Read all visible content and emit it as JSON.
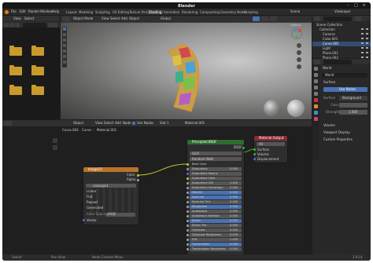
{
  "app": {
    "title": "Blender"
  },
  "menus": [
    "File",
    "Edit",
    "Render",
    "Window",
    "Help"
  ],
  "workspaces": [
    "Layout",
    "Modeling",
    "Sculpting",
    "UV Editing",
    "Texture Paint",
    "Shading",
    "Animation",
    "Rendering",
    "Compositing",
    "Geometry Nodes",
    "Scripting"
  ],
  "active_workspace": "Shading",
  "scene": "Scene",
  "view_layer": "ViewLayer",
  "file_browser": {
    "menu": [
      "View",
      "Select"
    ]
  },
  "viewport": {
    "mode": "Object Mode",
    "menu": [
      "View",
      "Select",
      "Add",
      "Object"
    ],
    "orientation": "Global",
    "options": "Options"
  },
  "outliner": {
    "root": "Scene Collection",
    "items": [
      "Collection",
      "Camera",
      "Cube.001",
      "Curve.001",
      "Light",
      "Plane.001",
      "Plane.002"
    ]
  },
  "properties": {
    "world_tab": "World",
    "world": "World",
    "surface_tab": "Surface",
    "use_nodes": "Use Nodes",
    "surface_label": "Surface",
    "surface_value": "Background",
    "color_label": "Color",
    "strength_label": "Strength",
    "strength_value": "1.000",
    "volume": "Volume",
    "viewport_display": "Viewport Display",
    "custom_props": "Custom Properties"
  },
  "node_editor": {
    "mode": "Object",
    "menu": [
      "View",
      "Select",
      "Add",
      "Node"
    ],
    "use_nodes": "Use Nodes",
    "slot": "Slot 1",
    "material": "Material.001",
    "breadcrumb": [
      "Curve.001",
      "Curve",
      "Material.001"
    ]
  },
  "image_node": {
    "title": "Image(1)",
    "color": "Color",
    "alpha": "Alpha",
    "image": "vasiurgn1",
    "linear": "Linear",
    "flat": "Flat",
    "repeat": "Repeat",
    "generated": "Generated",
    "color_space_label": "Color Space",
    "color_space": "sRGB",
    "vector": "Vector"
  },
  "bsdf_node": {
    "title": "Principled BSDF",
    "bsdf": "BSDF",
    "ggx": "GGX",
    "random_walk": "Random Walk",
    "inputs": [
      "Base Color",
      "Subsurface",
      "Subsurface Radius",
      "Subsurface Color",
      "Subsurface IOR",
      "Subsurface Anisotropy",
      "Metallic",
      "Specular",
      "Specular Tint",
      "Roughness",
      "Anisotropic",
      "Anisotropic Rotation",
      "Sheen",
      "Sheen Tint",
      "Clearcoat",
      "Clearcoat Roughness",
      "IOR",
      "Transmission",
      "Transmission Roughness"
    ],
    "values": [
      "",
      "0.000",
      "",
      "",
      "1.400",
      "0.000",
      "0.000",
      "0.500",
      "0.000",
      "0.500",
      "0.000",
      "0.000",
      "0.000",
      "0.500",
      "0.000",
      "0.030",
      "1.450",
      "0.000",
      "0.000"
    ]
  },
  "output_node": {
    "title": "Material Output",
    "target": "All",
    "outputs": [
      "Surface",
      "Volume",
      "Displacement"
    ]
  },
  "status": {
    "select": "Select",
    "pan": "Pan View",
    "node": "Node Context Menu",
    "version": "2.93.4"
  },
  "colors": {
    "accent": "#4772b3",
    "image_header": "#b8722a",
    "bsdf_header": "#2f6b2f",
    "output_header": "#8a2a36",
    "folder": "#c99a2c"
  }
}
